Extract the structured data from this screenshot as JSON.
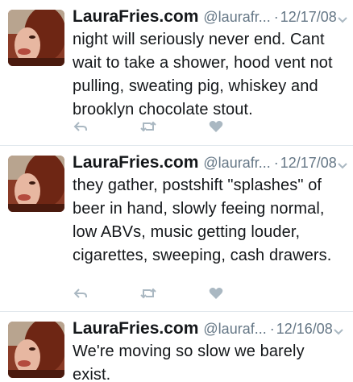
{
  "tweets": [
    {
      "name": "LauraFries.com",
      "handle": "@laurafr...",
      "dot": "·",
      "date": "12/17/08",
      "text": "night will seriously never end. Cant wait to take a shower, hood vent not pulling, sweating pig, whiskey and brooklyn chocolate stout."
    },
    {
      "name": "LauraFries.com",
      "handle": "@laurafr...",
      "dot": "·",
      "date": "12/17/08",
      "text": "they gather, postshift \"splashes\" of beer in hand, slowly feeing normal, low ABVs, music getting louder, cigarettes, sweeping, cash drawers."
    },
    {
      "name": "LauraFries.com",
      "handle": "@lauraf...",
      "dot": "·",
      "date": "12/16/08",
      "text": "We're moving so slow we barely exist."
    }
  ],
  "icons": {
    "reply": "reply-icon",
    "retweet": "retweet-icon",
    "like": "heart-icon",
    "menu": "chevron-down-icon"
  },
  "colors": {
    "text": "#14171a",
    "secondary": "#657786",
    "icon": "#aab8c2",
    "divider": "#e1e8ed"
  }
}
